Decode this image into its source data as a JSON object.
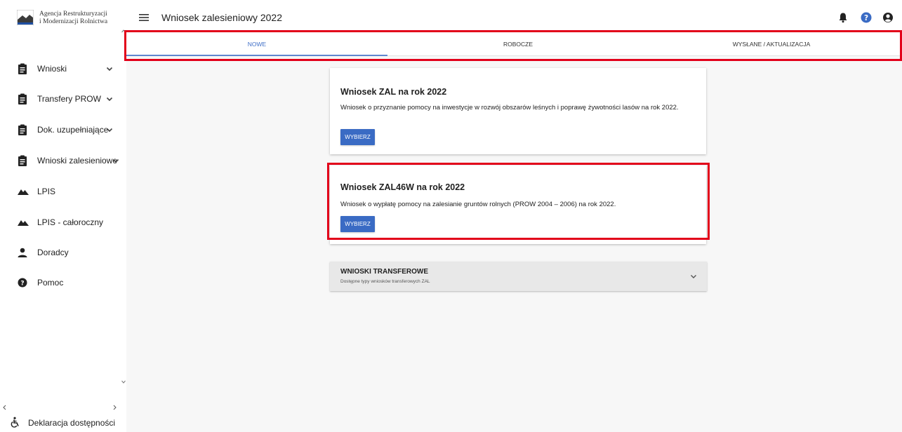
{
  "sidebar": {
    "logo_line1": "Agencja Restrukturyzacji",
    "logo_line2": "i Modernizacji Rolnictwa",
    "items": [
      {
        "label": "Wnioski",
        "icon": "clipboard-icon",
        "has_chevron": true
      },
      {
        "label": "Transfery PROW",
        "icon": "clipboard-icon",
        "has_chevron": true
      },
      {
        "label": "Dok. uzupełniające",
        "icon": "clipboard-icon",
        "has_chevron": true
      },
      {
        "label": "Wnioski zalesieniowe",
        "icon": "clipboard-icon",
        "has_chevron": true
      },
      {
        "label": "LPIS",
        "icon": "terrain-icon",
        "has_chevron": false
      },
      {
        "label": "LPIS - całoroczny",
        "icon": "terrain-icon",
        "has_chevron": false
      },
      {
        "label": "Doradcy",
        "icon": "person-icon",
        "has_chevron": false
      },
      {
        "label": "Pomoc",
        "icon": "help-icon",
        "has_chevron": false
      }
    ],
    "accessibility_label": "Deklaracja dostępności"
  },
  "header": {
    "title": "Wniosek zalesieniowy 2022",
    "icons": [
      "bell-icon",
      "help-circle-icon",
      "account-icon"
    ]
  },
  "tabs": [
    {
      "label": "NOWE",
      "active": true
    },
    {
      "label": "ROBOCZE",
      "active": false
    },
    {
      "label": "WYSŁANE / AKTUALIZACJA",
      "active": false
    }
  ],
  "cards": [
    {
      "title": "Wniosek ZAL na rok 2022",
      "description": "Wniosek o przyznanie pomocy na inwestycje w rozwój obszarów leśnych i poprawę żywotności lasów na rok 2022.",
      "button": "WYBIERZ"
    },
    {
      "title": "Wniosek ZAL46W na rok 2022",
      "description": "Wniosek o wypłatę pomocy na zalesianie gruntów rolnych (PROW 2004 – 2006) na rok 2022.",
      "button": "WYBIERZ"
    }
  ],
  "panel": {
    "title": "WNIOSKI TRANSFEROWE",
    "subtitle": "Dostępne typy wniosków transferowych ZAL"
  },
  "colors": {
    "accent": "#3a6bc4",
    "annotation": "#e2001a",
    "background": "#f7f7f7"
  }
}
